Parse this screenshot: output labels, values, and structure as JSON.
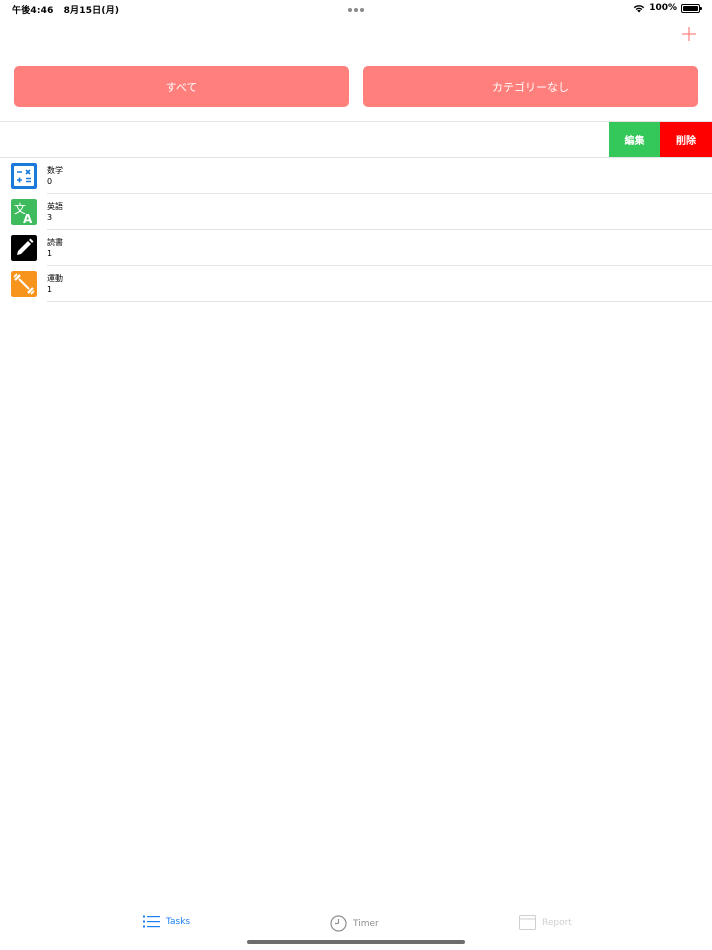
{
  "status_bar": {
    "time": "午後4:46",
    "date": "8月15日(月)",
    "battery_percent": "100%"
  },
  "header": {
    "add_icon": "plus-icon",
    "accent_color": "#ff7f7c"
  },
  "filters": {
    "all_label": "すべて",
    "none_label": "カテゴリーなし"
  },
  "swipe_actions": {
    "edit_label": "編集",
    "delete_label": "削除",
    "edit_color": "#34c759",
    "delete_color": "#ff0000"
  },
  "categories": [
    {
      "name": "数学",
      "count": "0",
      "icon": "calculator-icon",
      "color": "#1a7bd9"
    },
    {
      "name": "英語",
      "count": "3",
      "icon": "translate-icon",
      "color": "#3dbb5d"
    },
    {
      "name": "読書",
      "count": "1",
      "icon": "pencil-icon",
      "color": "#000000"
    },
    {
      "name": "運動",
      "count": "1",
      "icon": "dumbbell-icon",
      "color": "#f7941d"
    }
  ],
  "tab_bar": {
    "tasks_label": "Tasks",
    "timer_label": "Timer",
    "report_label": "Report",
    "active_color": "#1a7ff5"
  }
}
